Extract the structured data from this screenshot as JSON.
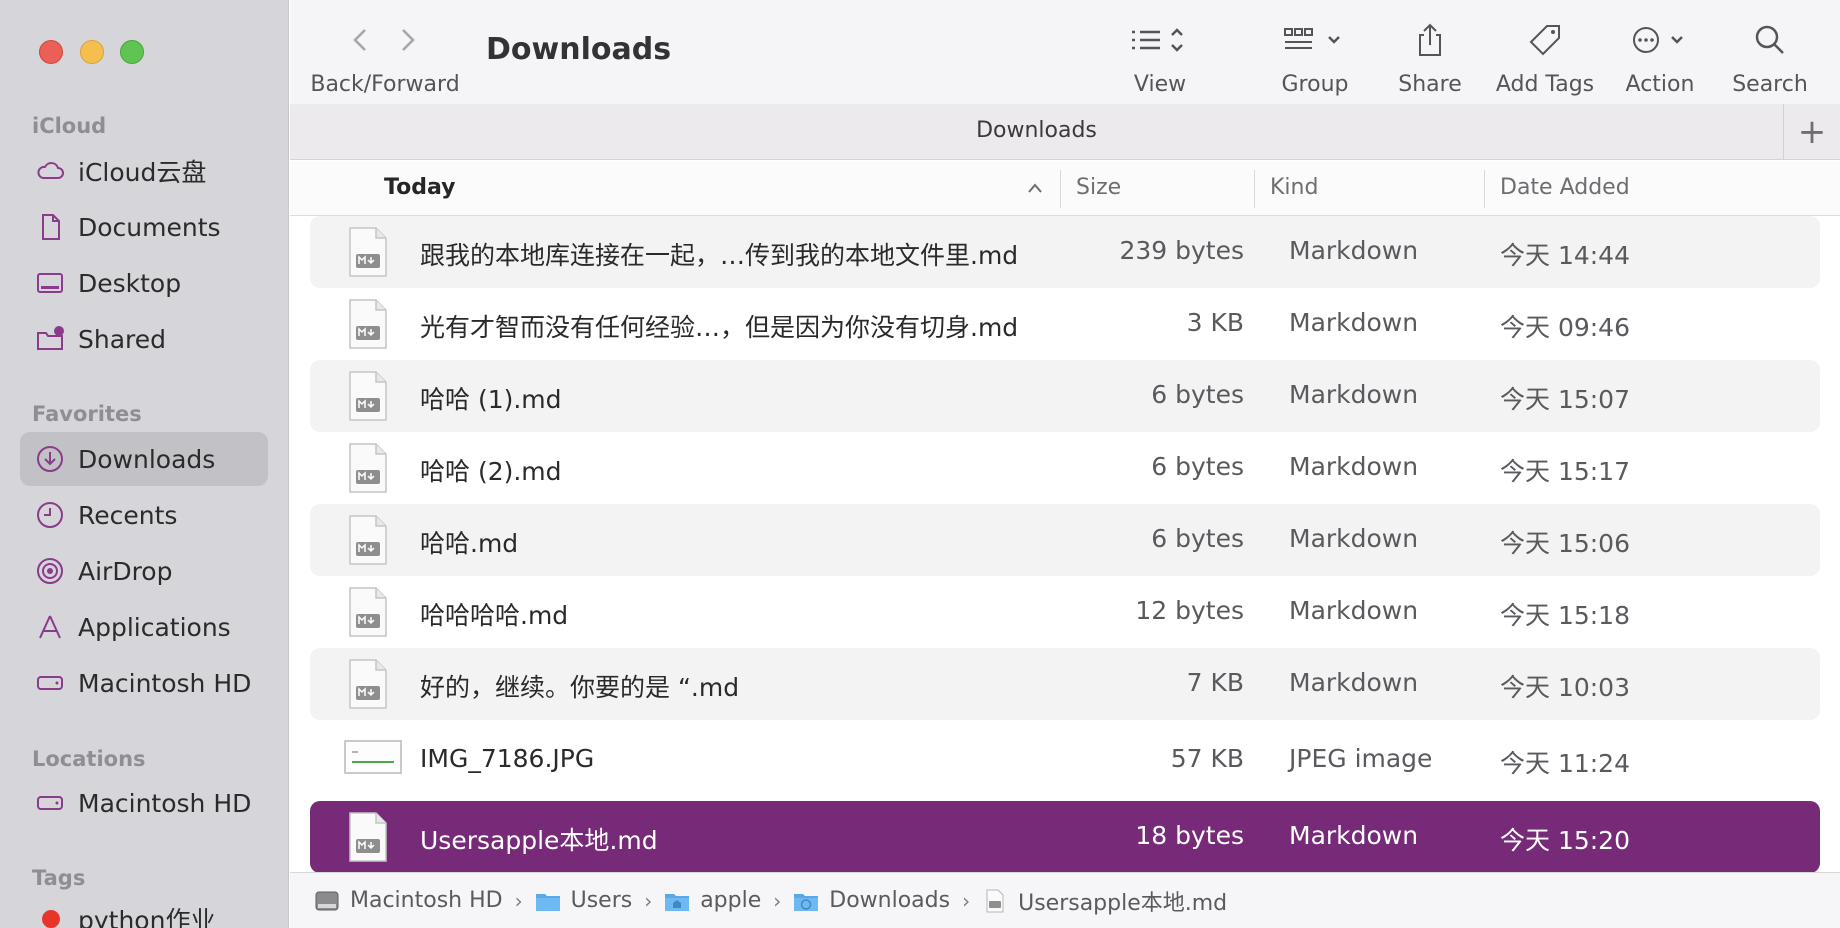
{
  "sidebar": {
    "sections": {
      "icloud": "iCloud",
      "favorites": "Favorites",
      "locations": "Locations",
      "tags": "Tags"
    },
    "icloud_items": [
      {
        "label": "iCloud云盘",
        "icon": "cloud-icon"
      },
      {
        "label": "Documents",
        "icon": "document-icon"
      },
      {
        "label": "Desktop",
        "icon": "desktop-icon"
      },
      {
        "label": "Shared",
        "icon": "shared-folder-icon"
      }
    ],
    "favorite_items": [
      {
        "label": "Downloads",
        "icon": "downloads-icon",
        "active": true
      },
      {
        "label": "Recents",
        "icon": "clock-icon"
      },
      {
        "label": "AirDrop",
        "icon": "airdrop-icon"
      },
      {
        "label": "Applications",
        "icon": "applications-icon"
      },
      {
        "label": "Macintosh HD",
        "icon": "drive-icon"
      }
    ],
    "location_items": [
      {
        "label": "Macintosh HD",
        "icon": "drive-icon"
      }
    ],
    "tag_items": [
      {
        "label": "python作业",
        "color": "#e8352c"
      }
    ]
  },
  "toolbar": {
    "nav_label": "Back/Forward",
    "title": "Downloads",
    "view_label": "View",
    "group_label": "Group",
    "share_label": "Share",
    "tags_label": "Add Tags",
    "action_label": "Action",
    "search_label": "Search"
  },
  "tab": {
    "title": "Downloads",
    "add": "+"
  },
  "columns": {
    "name": "Today",
    "size": "Size",
    "kind": "Kind",
    "date": "Date Added"
  },
  "files": [
    {
      "name": "跟我的本地库连接在一起，…传到我的本地文件里.md",
      "size": "239 bytes",
      "kind": "Markdown",
      "date": "今天 14:44",
      "icon": "markdown-file-icon"
    },
    {
      "name": "光有才智而没有任何经验…，但是因为你没有切身.md",
      "size": "3 KB",
      "kind": "Markdown",
      "date": "今天 09:46",
      "icon": "markdown-file-icon"
    },
    {
      "name": "哈哈 (1).md",
      "size": "6 bytes",
      "kind": "Markdown",
      "date": "今天 15:07",
      "icon": "markdown-file-icon"
    },
    {
      "name": "哈哈 (2).md",
      "size": "6 bytes",
      "kind": "Markdown",
      "date": "今天 15:17",
      "icon": "markdown-file-icon"
    },
    {
      "name": "哈哈.md",
      "size": "6 bytes",
      "kind": "Markdown",
      "date": "今天 15:06",
      "icon": "markdown-file-icon"
    },
    {
      "name": "哈哈哈哈.md",
      "size": "12 bytes",
      "kind": "Markdown",
      "date": "今天 15:18",
      "icon": "markdown-file-icon"
    },
    {
      "name": "好的，继续。你要的是 “.md",
      "size": "7 KB",
      "kind": "Markdown",
      "date": "今天 10:03",
      "icon": "markdown-file-icon"
    },
    {
      "name": "IMG_7186.JPG",
      "size": "57 KB",
      "kind": "JPEG image",
      "date": "今天 11:24",
      "icon": "image-thumbnail-icon"
    },
    {
      "name": "Usersapple本地.md",
      "size": "18 bytes",
      "kind": "Markdown",
      "date": "今天 15:20",
      "icon": "markdown-file-icon",
      "selected": true
    }
  ],
  "path": [
    {
      "label": "Macintosh HD",
      "icon": "drive-icon"
    },
    {
      "label": "Users",
      "icon": "folder-icon"
    },
    {
      "label": "apple",
      "icon": "home-folder-icon"
    },
    {
      "label": "Downloads",
      "icon": "downloads-folder-icon"
    },
    {
      "label": "Usersapple本地.md",
      "icon": "markdown-file-icon"
    }
  ],
  "path_separator": "›",
  "colors": {
    "selection": "#762a78",
    "sidebar_bg": "#d6d5d9",
    "accent_icon": "#8a3b8c"
  }
}
